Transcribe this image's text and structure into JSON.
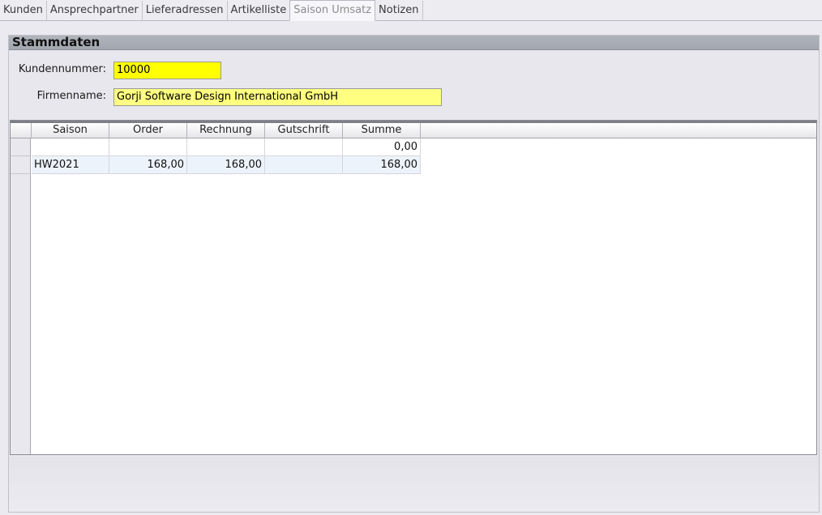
{
  "tabs": [
    {
      "label": "Kunden"
    },
    {
      "label": "Ansprechpartner"
    },
    {
      "label": "Lieferadressen"
    },
    {
      "label": "Artikelliste"
    },
    {
      "label": "Saison Umsatz"
    },
    {
      "label": "Notizen"
    }
  ],
  "section": {
    "title": "Stammdaten"
  },
  "form": {
    "kundennummer_label": "Kundennummer:",
    "kundennummer_value": "10000",
    "firmenname_label": "Firmenname:",
    "firmenname_value": "Gorji Software Design International  GmbH"
  },
  "table": {
    "columns": [
      "Saison",
      "Order",
      "Rechnung",
      "Gutschrift",
      "Summe"
    ],
    "rows": [
      [
        "",
        "",
        "",
        "",
        "0,00"
      ],
      [
        "HW2021",
        "168,00",
        "168,00",
        "",
        "168,00"
      ]
    ]
  },
  "colors": {
    "kundennummer_bg": "#ffff00",
    "firmenname_bg": "#ffff80",
    "header_band": "#a8acb4"
  }
}
